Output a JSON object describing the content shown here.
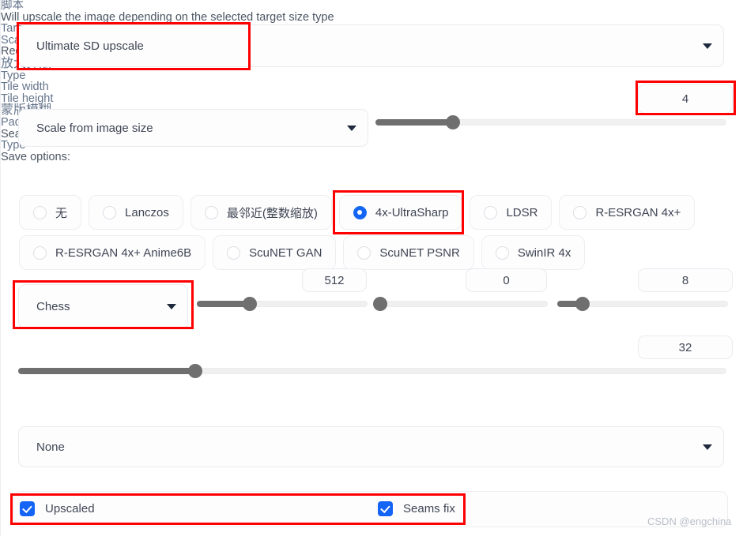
{
  "script_section": {
    "label": "脚本",
    "selected": "Ultimate SD upscale",
    "caret_icon": "chevron-down-icon",
    "description": "Will upscale the image depending on the selected target size type"
  },
  "target_size": {
    "label": "Target size type",
    "selected": "Scale from image size",
    "caret_icon": "chevron-down-icon"
  },
  "scale": {
    "label": "Scale",
    "value": "4",
    "slider_percent": 22
  },
  "redraw": {
    "heading": "Redraw options:",
    "upscaler_label": "放大算法",
    "options": [
      {
        "label": "无",
        "checked": false
      },
      {
        "label": "Lanczos",
        "checked": false
      },
      {
        "label": "最邻近(整数缩放)",
        "checked": false
      },
      {
        "label": "4x-UltraSharp",
        "checked": true
      },
      {
        "label": "LDSR",
        "checked": false
      },
      {
        "label": "R-ESRGAN 4x+",
        "checked": false
      },
      {
        "label": "R-ESRGAN 4x+ Anime6B",
        "checked": false
      },
      {
        "label": "ScuNET GAN",
        "checked": false
      },
      {
        "label": "ScuNET PSNR",
        "checked": false
      },
      {
        "label": "SwinIR 4x",
        "checked": false
      }
    ]
  },
  "type_field": {
    "label": "Type",
    "selected": "Chess",
    "caret_icon": "chevron-down-icon"
  },
  "tile_width": {
    "label": "Tile width",
    "value": "512",
    "slider_percent": 31
  },
  "tile_height": {
    "label": "Tile height",
    "value": "0",
    "slider_percent": 2
  },
  "mask_blur": {
    "label": "蒙版模糊",
    "value": "8",
    "slider_percent": 15
  },
  "padding": {
    "label": "Padding",
    "value": "32",
    "slider_percent": 25
  },
  "seams_fix": {
    "heading": "Seams fix:",
    "type_label": "Type",
    "selected": "None",
    "caret_icon": "chevron-down-icon"
  },
  "save_options": {
    "heading": "Save options:",
    "upscaled": {
      "label": "Upscaled",
      "checked": true
    },
    "seams_fix": {
      "label": "Seams fix",
      "checked": true
    }
  },
  "watermark": "CSDN @engchina",
  "colors": {
    "accent": "#1464f6",
    "annotation": "#ff0000",
    "slider_fill": "#6f6f6f",
    "muted_text": "#64748b"
  }
}
